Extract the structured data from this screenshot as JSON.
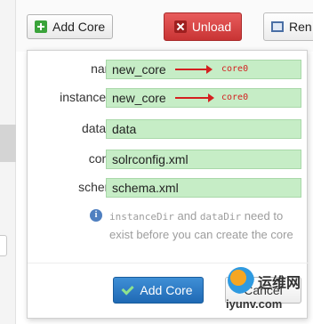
{
  "toolbar": {
    "add_core_label": "Add Core",
    "unload_label": "Unload",
    "rename_label": "Ren"
  },
  "form": {
    "fields": [
      {
        "label": "name:",
        "value": "new_core"
      },
      {
        "label": "instanceDir:",
        "value": "new_core"
      },
      {
        "label": "dataDir:",
        "value": "data"
      },
      {
        "label": "config:",
        "value": "solrconfig.xml"
      },
      {
        "label": "schema:",
        "value": "schema.xml"
      }
    ],
    "annotations": {
      "name_note": "core0",
      "instance_note": "core0"
    },
    "info": {
      "instance_dir_term": "instanceDir",
      "and_word": "and",
      "data_dir_term": "dataDir",
      "message_rest": "need to exist before you can create the core"
    },
    "submit_label": "Add Core",
    "cancel_label": "Cancel"
  },
  "watermark": {
    "site_cn": "运维网",
    "url": "iyunv.com"
  },
  "colors": {
    "input_bg": "#c6edc6",
    "unload_red": "#d44545",
    "primary_blue": "#2a78c4",
    "annotation_red": "#d42020"
  },
  "icons": {
    "add": "plus-icon",
    "unload": "x-icon",
    "rename": "rename-icon",
    "info": "info-icon",
    "submit": "check-icon"
  }
}
